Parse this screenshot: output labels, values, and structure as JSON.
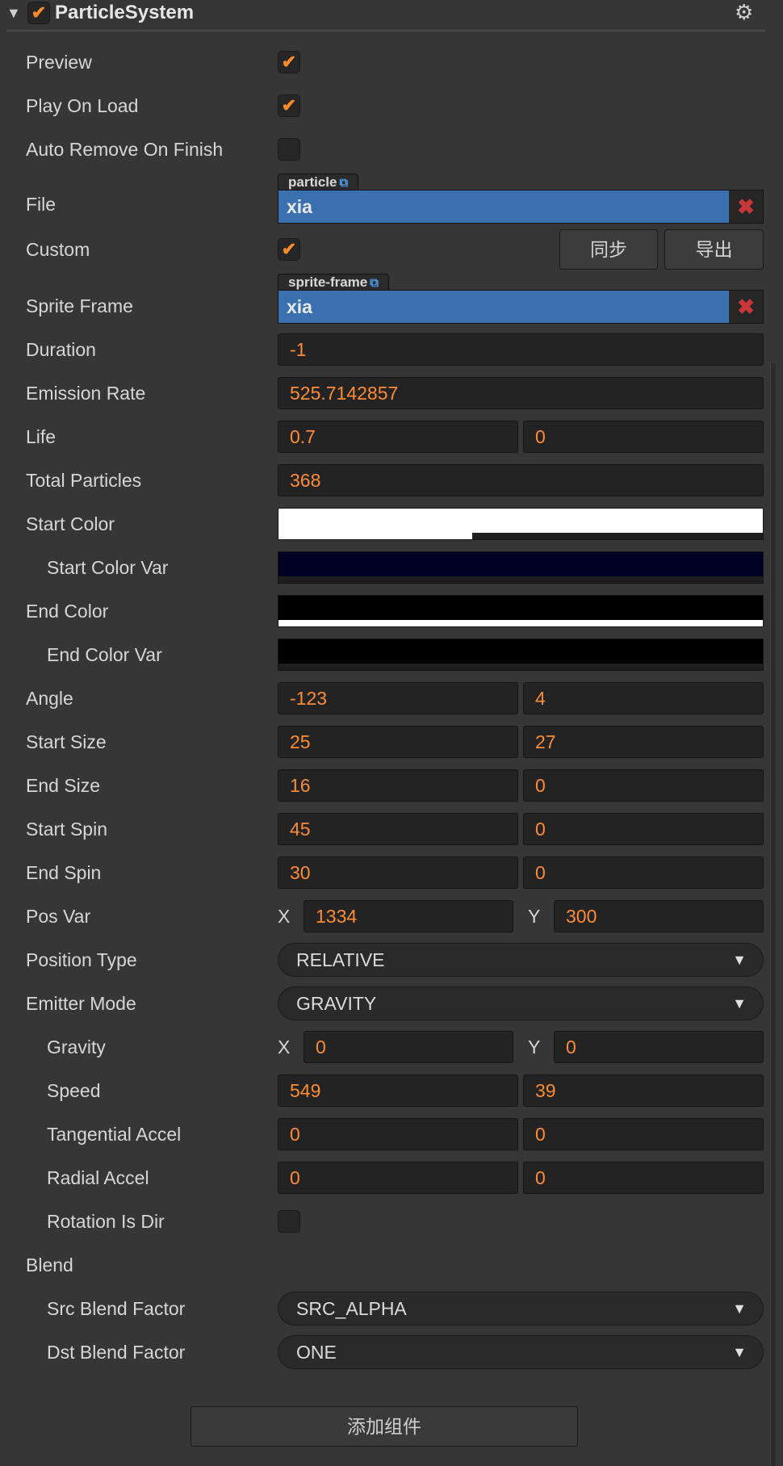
{
  "header": {
    "expand_glyph": "▼",
    "enabled_glyph": "✔",
    "title": "ParticleSystem",
    "settings_glyph": "⚙"
  },
  "check_glyph": "✔",
  "select_glyph": "▼",
  "clear_glyph": "✖",
  "link_glyph": "⧉",
  "props": {
    "preview": {
      "label": "Preview",
      "checked": true
    },
    "play_on_load": {
      "label": "Play On Load",
      "checked": true
    },
    "auto_remove": {
      "label": "Auto Remove On Finish",
      "checked": false
    },
    "file": {
      "label": "File",
      "tag": "particle",
      "value": "xia"
    },
    "custom": {
      "label": "Custom",
      "checked": true,
      "sync_label": "同步",
      "export_label": "导出"
    },
    "sprite_frame": {
      "label": "Sprite Frame",
      "tag": "sprite-frame",
      "value": "xia"
    },
    "duration": {
      "label": "Duration",
      "value": "-1"
    },
    "emission_rate": {
      "label": "Emission Rate",
      "value": "525.7142857"
    },
    "life": {
      "label": "Life",
      "value": "0.7",
      "var": "0"
    },
    "total_particles": {
      "label": "Total Particles",
      "value": "368"
    },
    "start_color": {
      "label": "Start Color",
      "color": "#ffffff",
      "alpha": 0.4
    },
    "start_color_var": {
      "label": "Start Color Var",
      "color": "#000022",
      "alpha": 0
    },
    "end_color": {
      "label": "End Color",
      "color": "#000000",
      "alpha": 1
    },
    "end_color_var": {
      "label": "End Color Var",
      "color": "#000000",
      "alpha": 0
    },
    "angle": {
      "label": "Angle",
      "value": "-123",
      "var": "4"
    },
    "start_size": {
      "label": "Start Size",
      "value": "25",
      "var": "27"
    },
    "end_size": {
      "label": "End Size",
      "value": "16",
      "var": "0"
    },
    "start_spin": {
      "label": "Start Spin",
      "value": "45",
      "var": "0"
    },
    "end_spin": {
      "label": "End Spin",
      "value": "30",
      "var": "0"
    },
    "pos_var": {
      "label": "Pos Var",
      "x_label": "X",
      "x": "1334",
      "y_label": "Y",
      "y": "300"
    },
    "position_type": {
      "label": "Position Type",
      "value": "RELATIVE"
    },
    "emitter_mode": {
      "label": "Emitter Mode",
      "value": "GRAVITY"
    },
    "gravity": {
      "label": "Gravity",
      "x_label": "X",
      "x": "0",
      "y_label": "Y",
      "y": "0"
    },
    "speed": {
      "label": "Speed",
      "value": "549",
      "var": "39"
    },
    "tangential_accel": {
      "label": "Tangential Accel",
      "value": "0",
      "var": "0"
    },
    "radial_accel": {
      "label": "Radial Accel",
      "value": "0",
      "var": "0"
    },
    "rotation_is_dir": {
      "label": "Rotation Is Dir",
      "checked": false
    },
    "blend": {
      "label": "Blend"
    },
    "src_blend": {
      "label": "Src Blend Factor",
      "value": "SRC_ALPHA"
    },
    "dst_blend": {
      "label": "Dst Blend Factor",
      "value": "ONE"
    }
  },
  "add_component_label": "添加组件",
  "colors": {
    "accent_orange": "#ff8c33",
    "asset_blue": "#3a6fb0",
    "panel_bg": "#363636"
  }
}
